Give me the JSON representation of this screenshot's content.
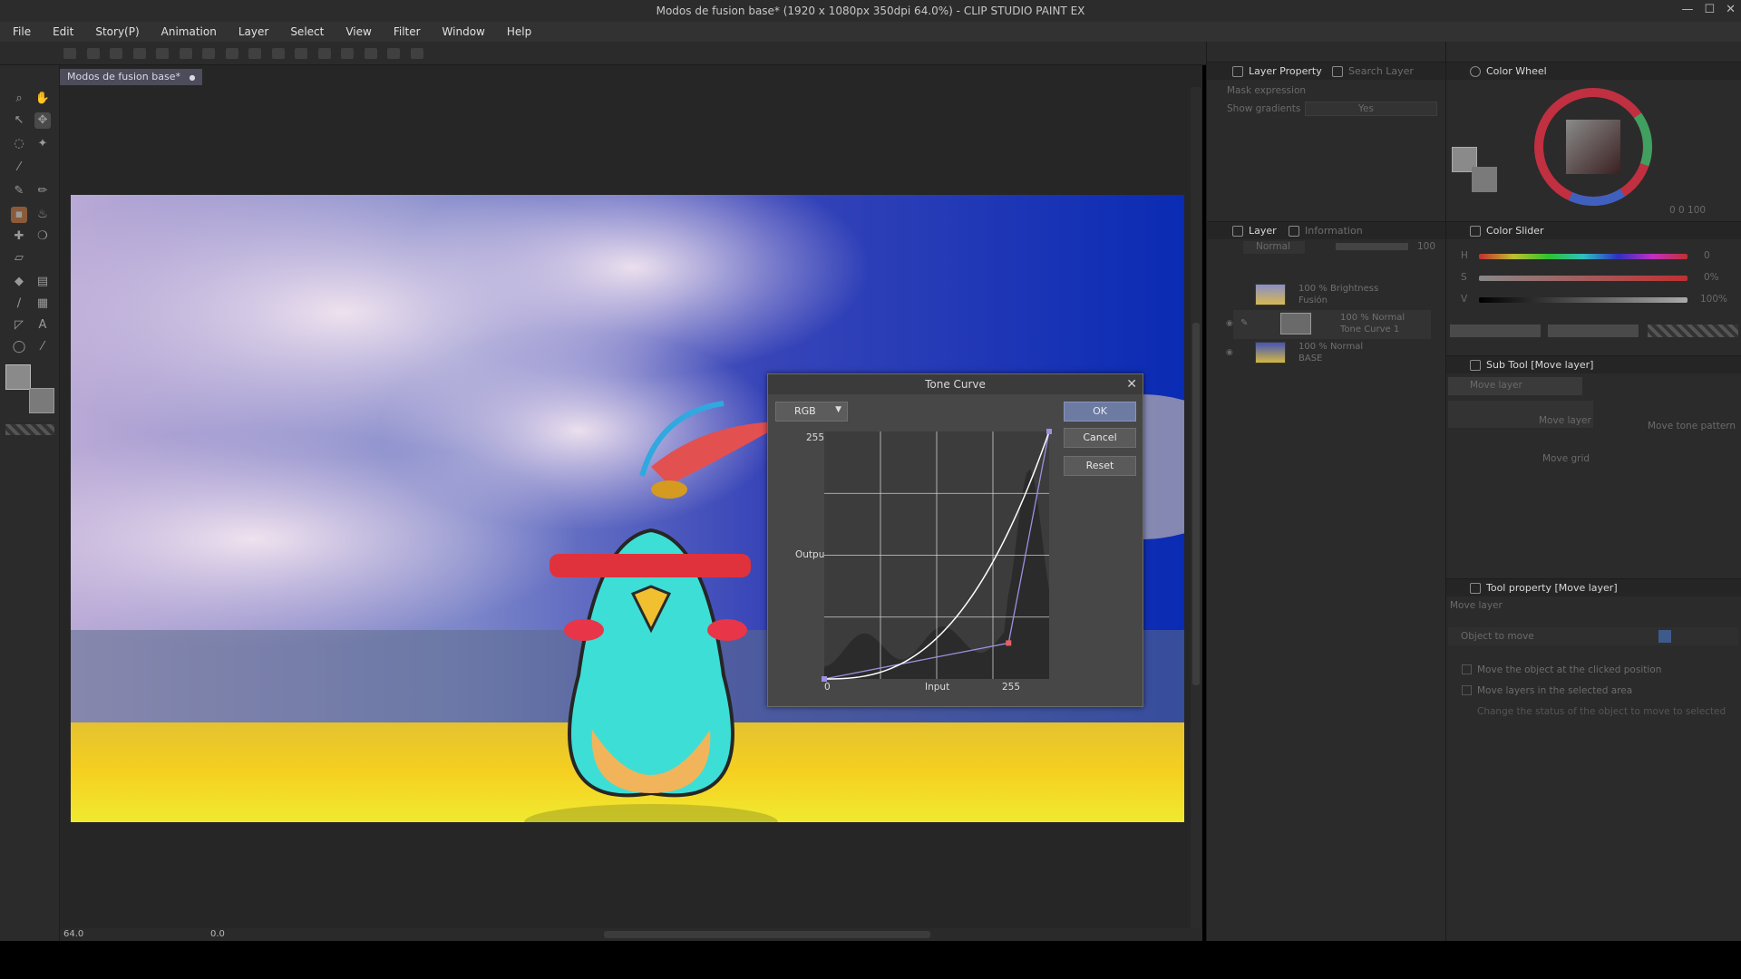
{
  "window": {
    "title": "Modos de fusion base* (1920 x 1080px 350dpi 64.0%)  - CLIP STUDIO PAINT EX",
    "controls": [
      "—",
      "☐",
      "✕"
    ]
  },
  "menu": [
    "File",
    "Edit",
    "Story(P)",
    "Animation",
    "Layer",
    "Select",
    "View",
    "Filter",
    "Window",
    "Help"
  ],
  "document_tab": {
    "label": "Modos de fusion base*"
  },
  "status": {
    "zoom": "64.0",
    "angle": "0.0"
  },
  "panels": {
    "layer_property_tab": "Layer Property",
    "search_layer_tab": "Search Layer",
    "mask_expression": "Mask expression",
    "show_gradients_label": "Show gradients",
    "show_gradients_value": "Yes",
    "color_wheel_tab": "Color Wheel",
    "color_slider_tab": "Color Slider",
    "slider_labels": [
      "H",
      "S",
      "V"
    ],
    "slider_values": [
      "0",
      "0%",
      "100%"
    ],
    "layer_tab": "Layer",
    "information_tab": "Information",
    "blend_mode": "Normal",
    "opacity": "100",
    "layers": [
      {
        "line1": "100 % Brightness",
        "line2": "Fusión"
      },
      {
        "line1": "100 % Normal",
        "line2": "Tone Curve 1"
      },
      {
        "line1": "100 % Normal",
        "line2": "BASE"
      }
    ],
    "sub_tool_tab": "Sub Tool [Move layer]",
    "sub_tool_group": "Move layer",
    "sub_tools": [
      "Move layer",
      "Move tone pattern",
      "Move grid"
    ],
    "tool_property_tab": "Tool property [Move layer]",
    "tool_property_name": "Move layer",
    "object_to_move": "Object to move",
    "options": [
      "Move the object at the clicked position",
      "Move layers in the selected area",
      "Change the status of the object to move to selected"
    ],
    "color_wheel_readout": "0  0  100"
  },
  "tone_curve": {
    "title": "Tone Curve",
    "channel": "RGB",
    "buttons": {
      "ok": "OK",
      "cancel": "Cancel",
      "reset": "Reset"
    },
    "axis": {
      "y_max": "255",
      "y_label": "Output",
      "x_min": "0",
      "x_label": "Input",
      "x_max": "255"
    },
    "control_points": [
      [
        0,
        0
      ],
      [
        209,
        37
      ],
      [
        255,
        255
      ]
    ]
  },
  "colors": {
    "accent": "#6d7ba3",
    "curve": "#ffffff",
    "control_line": "#9e8fe0",
    "point_marker": "#e86060"
  }
}
